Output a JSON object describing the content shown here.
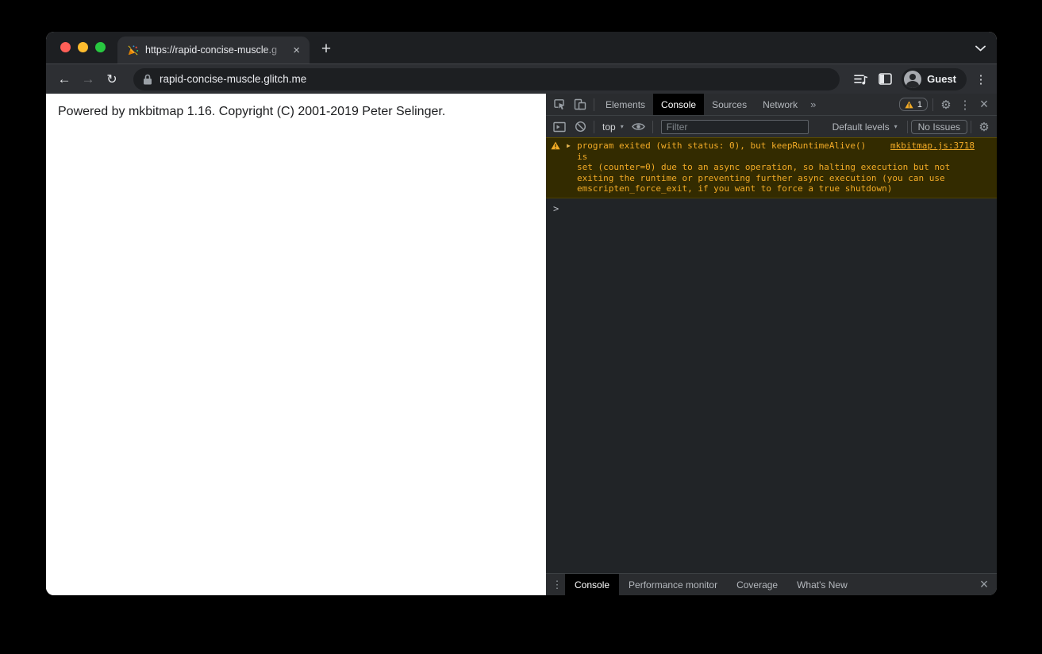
{
  "browser": {
    "tab": {
      "title": "https://rapid-concise-muscle.g",
      "close_glyph": "×"
    },
    "new_tab_glyph": "+",
    "nav": {
      "back_glyph": "←",
      "forward_glyph": "→",
      "reload_glyph": "↻"
    },
    "omnibox": {
      "url": "rapid-concise-muscle.glitch.me"
    },
    "profile_label": "Guest",
    "menu_glyph": "⋮"
  },
  "page": {
    "text": "Powered by mkbitmap 1.16. Copyright (C) 2001-2019 Peter Selinger."
  },
  "devtools": {
    "tabs": [
      "Elements",
      "Console",
      "Sources",
      "Network"
    ],
    "active_tab": "Console",
    "overflow_glyph": "»",
    "warning_badge_count": "1",
    "settings_glyph": "⚙",
    "menu_glyph": "⋮",
    "close_glyph": "×",
    "console_toolbar": {
      "context": "top",
      "caret_glyph": "▾",
      "filter_placeholder": "Filter",
      "levels": "Default levels",
      "issues": "No Issues",
      "settings_glyph": "⚙"
    },
    "console": {
      "warning": {
        "expand_glyph": "▶",
        "lines": [
          "program exited (with status: 0), but keepRuntimeAlive() is",
          "set (counter=0) due to an async operation, so halting execution but not",
          "exiting the runtime or preventing further async execution (you can use",
          "emscripten_force_exit, if you want to force a true shutdown)"
        ],
        "source_link": "mkbitmap.js:3718"
      },
      "prompt_glyph": ">"
    },
    "drawer": {
      "menu_glyph": "⋮",
      "tabs": [
        "Console",
        "Performance monitor",
        "Coverage",
        "What's New"
      ],
      "active_tab": "Console",
      "close_glyph": "×"
    }
  },
  "colors": {
    "traffic_red": "#ff5f57",
    "traffic_yellow": "#febc2e",
    "traffic_green": "#28c840",
    "warning_bg": "#332b00",
    "warning_text": "#f2ab26",
    "chrome_frame": "#1d1f22",
    "chrome_toolbar": "#2d2f33",
    "devtools_bg": "#212427",
    "devtools_toolbar_bg": "#2a2c2f"
  }
}
